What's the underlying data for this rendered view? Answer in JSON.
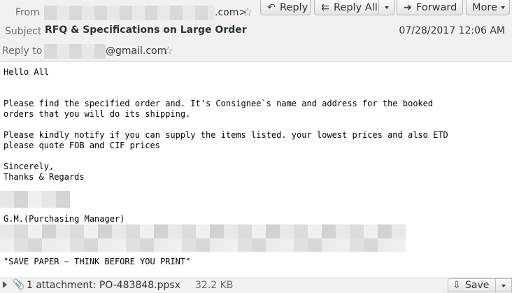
{
  "header": {
    "from_label": "From",
    "from_value_suffix": ".com>",
    "subject_label": "Subject",
    "subject": "RFQ & Specifications on Large Order",
    "date": "07/28/2017 12:06 AM",
    "reply_to_label": "Reply to",
    "reply_to_suffix": "@gmail.com"
  },
  "toolbar": {
    "reply_label": "Reply",
    "reply_all_label": "Reply All",
    "forward_label": "Forward",
    "more_label": "More"
  },
  "message": {
    "greeting": "Hello All",
    "para1_line1": "Please find the specified order and. It's Consignee`s name and address for the booked",
    "para1_line2": "orders that you will do its shipping.",
    "para2_line1": "Please kindly notify if you can supply the items listed. your lowest prices and also ETD",
    "para2_line2": "please quote FOB and CIF prices",
    "closing1": "Sincerely,",
    "closing2": "Thanks & Regards",
    "signature_title": "G.M.(Purchasing Manager)",
    "footer_note": "\"SAVE PAPER – THINK BEFORE YOU PRINT\""
  },
  "attachment": {
    "summary": "1 attachment: PO-483848.ppsx",
    "size": "32.2 KB",
    "save_label": "Save"
  },
  "icons": [
    "star-icon",
    "reply-icon",
    "reply-all-icon",
    "forward-icon",
    "chevron-down-icon",
    "paperclip-icon",
    "download-icon"
  ]
}
